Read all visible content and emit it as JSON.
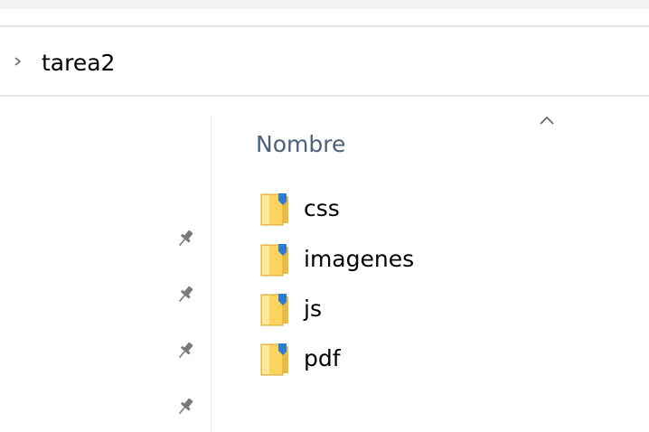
{
  "breadcrumb": {
    "label": "tarea2",
    "chevron_icon": "chevron-right-icon"
  },
  "file_list": {
    "sort_icon": "sort-ascending-caret-icon",
    "column_header": "Nombre",
    "items": [
      {
        "name": "css",
        "icon": "folder-icon"
      },
      {
        "name": "imagenes",
        "icon": "folder-icon"
      },
      {
        "name": "js",
        "icon": "folder-icon"
      },
      {
        "name": "pdf",
        "icon": "folder-icon"
      }
    ]
  },
  "quick_access": {
    "pin_icon": "pin-icon",
    "pin_count": 4
  },
  "colors": {
    "header_text": "#4c607a",
    "folder_fill": "#fbd35e",
    "folder_light": "#fde89a",
    "folder_badge": "#2c7dd1",
    "divider": "#e6e6e6",
    "pin": "#7a7a7a"
  }
}
